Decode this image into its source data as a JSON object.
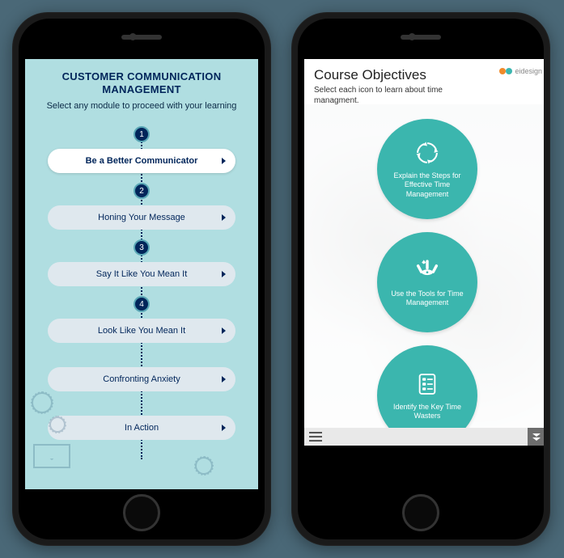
{
  "left": {
    "title": "CUSTOMER COMMUNICATION MANAGEMENT",
    "subtitle": "Select any module to proceed with your learning",
    "steps": [
      "1",
      "2",
      "3",
      "4"
    ],
    "modules": [
      {
        "label": "Be a Better Communicator",
        "active": true
      },
      {
        "label": "Honing Your Message",
        "active": false
      },
      {
        "label": "Say It Like You Mean It",
        "active": false
      },
      {
        "label": "Look Like You Mean It",
        "active": false
      },
      {
        "label": "Confronting Anxiety",
        "active": false
      },
      {
        "label": "In Action",
        "active": false
      }
    ]
  },
  "right": {
    "title": "Course Objectives",
    "subtitle": "Select each icon to learn about time managment.",
    "brand": "eidesign",
    "objectives": [
      {
        "icon": "cycle-icon",
        "label": "Explain the Steps for Effective Time Management"
      },
      {
        "icon": "tools-icon",
        "label": "Use the Tools for Time Management"
      },
      {
        "icon": "checklist-icon",
        "label": "Identify the Key Time Wasters"
      }
    ],
    "colors": {
      "accent": "#3bb6ae",
      "title_dark": "#00255a"
    }
  }
}
